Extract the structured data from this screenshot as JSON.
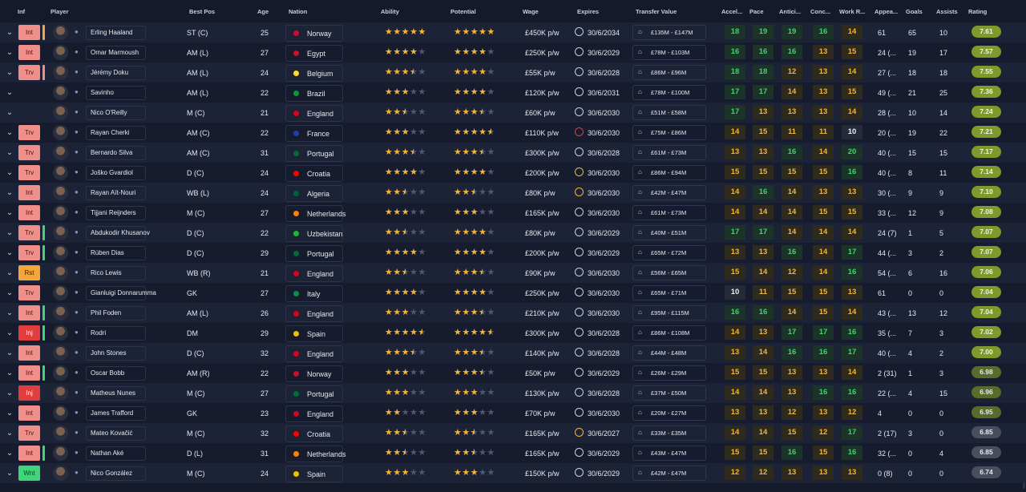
{
  "columns": {
    "inf": "Inf",
    "player": "Player",
    "best_pos": "Best Pos",
    "age": "Age",
    "nation": "Nation",
    "ability": "Ability",
    "potential": "Potential",
    "wage": "Wage",
    "expires": "Expires",
    "transfer_value": "Transfer Value",
    "accel": "Accel...",
    "pace": "Pace",
    "antic": "Antici...",
    "conc": "Conc...",
    "work": "Work R...",
    "appear": "Appea...",
    "goals": "Goals",
    "assists": "Assists",
    "rating": "Rating"
  },
  "colors": {
    "attr_high": "#46d06e",
    "attr_mid": "#f0b63c",
    "attr_low": "#e9eef5",
    "rating_good": "#7f9a2a",
    "rating_mid": "#5a6a2b",
    "rating_low": "#4a4e5c",
    "inf_trv": "#f08f8a",
    "inf_int": "#f08f8a",
    "inf_rst": "#f6a53a",
    "inf_inj": "#e23d3d",
    "inf_wnt": "#3fd67a",
    "star": "#f2b53b"
  },
  "players": [
    {
      "inf": "Int",
      "inf_bar": "#f6a53a",
      "name": "Erling Haaland",
      "best_pos": "ST (C)",
      "age": "25",
      "nation": "Norway",
      "flag": "#c8102e",
      "ability": 5,
      "potential": 5,
      "wage": "£450K p/w",
      "expires": "30/6/2034",
      "clock": "normal",
      "tv": "£135M - £147M",
      "accel": 18,
      "pace": 19,
      "antic": 19,
      "conc": 16,
      "work": 14,
      "appear": "61",
      "goals": "65",
      "assists": "10",
      "rating": "7.61"
    },
    {
      "inf": "Int",
      "inf_bar": "",
      "name": "Omar Marmoush",
      "best_pos": "AM (L)",
      "age": "27",
      "nation": "Egypt",
      "flag": "#ce1126",
      "ability": 4,
      "potential": 4,
      "wage": "£250K p/w",
      "expires": "30/6/2029",
      "clock": "normal",
      "tv": "£78M - £103M",
      "accel": 16,
      "pace": 16,
      "antic": 16,
      "conc": 13,
      "work": 15,
      "appear": "24 (...",
      "goals": "19",
      "assists": "17",
      "rating": "7.57"
    },
    {
      "inf": "Trv",
      "inf_bar": "#f08f8a",
      "name": "Jérémy Doku",
      "best_pos": "AM (L)",
      "age": "24",
      "nation": "Belgium",
      "flag": "#fdda24",
      "ability": 3.5,
      "potential": 4,
      "wage": "£55K p/w",
      "expires": "30/6/2028",
      "clock": "normal",
      "tv": "£86M - £96M",
      "accel": 18,
      "pace": 18,
      "antic": 12,
      "conc": 13,
      "work": 14,
      "appear": "27 (...",
      "goals": "18",
      "assists": "18",
      "rating": "7.55"
    },
    {
      "inf": "",
      "inf_bar": "",
      "name": "Savinho",
      "best_pos": "AM (L)",
      "age": "22",
      "nation": "Brazil",
      "flag": "#009c3b",
      "ability": 3,
      "potential": 4,
      "wage": "£120K p/w",
      "expires": "30/6/2031",
      "clock": "normal",
      "tv": "£78M - £100M",
      "accel": 17,
      "pace": 17,
      "antic": 14,
      "conc": 13,
      "work": 15,
      "appear": "49 (...",
      "goals": "21",
      "assists": "25",
      "rating": "7.36"
    },
    {
      "inf": "",
      "inf_bar": "",
      "name": "Nico O'Reilly",
      "best_pos": "M (C)",
      "age": "21",
      "nation": "England",
      "flag": "#cf081f",
      "ability": 2.5,
      "potential": 3.5,
      "wage": "£60K p/w",
      "expires": "30/6/2030",
      "clock": "normal",
      "tv": "£51M - £58M",
      "accel": 17,
      "pace": 13,
      "antic": 13,
      "conc": 13,
      "work": 14,
      "appear": "28 (...",
      "goals": "10",
      "assists": "14",
      "rating": "7.24"
    },
    {
      "inf": "Trv",
      "inf_bar": "",
      "name": "Rayan Cherki",
      "best_pos": "AM (C)",
      "age": "22",
      "nation": "France",
      "flag": "#1f3fa7",
      "ability": 3,
      "potential": 4.5,
      "wage": "£110K p/w",
      "expires": "30/6/2030",
      "clock": "danger",
      "tv": "£75M - £86M",
      "accel": 14,
      "pace": 15,
      "antic": 11,
      "conc": 11,
      "work": 10,
      "appear": "20 (...",
      "goals": "19",
      "assists": "22",
      "rating": "7.21"
    },
    {
      "inf": "Trv",
      "inf_bar": "",
      "name": "Bernardo Silva",
      "best_pos": "AM (C)",
      "age": "31",
      "nation": "Portugal",
      "flag": "#046a38",
      "ability": 3.5,
      "potential": 3.5,
      "wage": "£300K p/w",
      "expires": "30/6/2028",
      "clock": "normal",
      "tv": "£61M - £73M",
      "accel": 13,
      "pace": 13,
      "antic": 16,
      "conc": 14,
      "work": 20,
      "appear": "40 (...",
      "goals": "15",
      "assists": "15",
      "rating": "7.17"
    },
    {
      "inf": "Trv",
      "inf_bar": "",
      "name": "Joško Gvardiol",
      "best_pos": "D (C)",
      "age": "24",
      "nation": "Croatia",
      "flag": "#ff0000",
      "ability": 4,
      "potential": 4,
      "wage": "£200K p/w",
      "expires": "30/6/2030",
      "clock": "warn",
      "tv": "£86M - £94M",
      "accel": 15,
      "pace": 15,
      "antic": 15,
      "conc": 15,
      "work": 16,
      "appear": "40 (...",
      "goals": "8",
      "assists": "11",
      "rating": "7.14"
    },
    {
      "inf": "Int",
      "inf_bar": "",
      "name": "Rayan Aït-Nouri",
      "best_pos": "WB (L)",
      "age": "24",
      "nation": "Algeria",
      "flag": "#006233",
      "ability": 2.5,
      "potential": 2.5,
      "wage": "£80K p/w",
      "expires": "30/6/2030",
      "clock": "warn",
      "tv": "£42M - £47M",
      "accel": 14,
      "pace": 16,
      "antic": 14,
      "conc": 13,
      "work": 13,
      "appear": "30 (...",
      "goals": "9",
      "assists": "9",
      "rating": "7.10"
    },
    {
      "inf": "Int",
      "inf_bar": "",
      "name": "Tijjani Reijnders",
      "best_pos": "M (C)",
      "age": "27",
      "nation": "Netherlands",
      "flag": "#ff7f00",
      "ability": 3,
      "potential": 3,
      "wage": "£165K p/w",
      "expires": "30/6/2030",
      "clock": "normal",
      "tv": "£61M - £73M",
      "accel": 14,
      "pace": 14,
      "antic": 14,
      "conc": 15,
      "work": 15,
      "appear": "33 (...",
      "goals": "12",
      "assists": "9",
      "rating": "7.08"
    },
    {
      "inf": "Trv",
      "inf_bar": "#3fd67a",
      "name": "Abdukodir Khusanov",
      "best_pos": "D (C)",
      "age": "22",
      "nation": "Uzbekistan",
      "flag": "#1eb53a",
      "ability": 2.5,
      "potential": 4,
      "wage": "£80K p/w",
      "expires": "30/6/2029",
      "clock": "normal",
      "tv": "£40M - £51M",
      "accel": 17,
      "pace": 17,
      "antic": 14,
      "conc": 14,
      "work": 14,
      "appear": "24 (7)",
      "goals": "1",
      "assists": "5",
      "rating": "7.07"
    },
    {
      "inf": "Trv",
      "inf_bar": "#3fd67a",
      "name": "Rúben Dias",
      "best_pos": "D (C)",
      "age": "29",
      "nation": "Portugal",
      "flag": "#046a38",
      "ability": 4,
      "potential": 4,
      "wage": "£200K p/w",
      "expires": "30/6/2029",
      "clock": "normal",
      "tv": "£65M - £72M",
      "accel": 13,
      "pace": 13,
      "antic": 16,
      "conc": 14,
      "work": 17,
      "appear": "44 (...",
      "goals": "3",
      "assists": "2",
      "rating": "7.07"
    },
    {
      "inf": "Rst",
      "inf_bar": "",
      "name": "Rico Lewis",
      "best_pos": "WB (R)",
      "age": "21",
      "nation": "England",
      "flag": "#cf081f",
      "ability": 2.5,
      "potential": 3.5,
      "wage": "£90K p/w",
      "expires": "30/6/2030",
      "clock": "normal",
      "tv": "£56M - £65M",
      "accel": 15,
      "pace": 14,
      "antic": 12,
      "conc": 14,
      "work": 16,
      "appear": "54 (...",
      "goals": "6",
      "assists": "16",
      "rating": "7.06"
    },
    {
      "inf": "Trv",
      "inf_bar": "",
      "name": "Gianluigi Donnarumma",
      "best_pos": "GK",
      "age": "27",
      "nation": "Italy",
      "flag": "#009246",
      "ability": 4,
      "potential": 4,
      "wage": "£250K p/w",
      "expires": "30/6/2030",
      "clock": "normal",
      "tv": "£65M - £71M",
      "accel": 10,
      "pace": 11,
      "antic": 15,
      "conc": 15,
      "work": 13,
      "appear": "61",
      "goals": "0",
      "assists": "0",
      "rating": "7.04"
    },
    {
      "inf": "Int",
      "inf_bar": "#3fd67a",
      "name": "Phil Foden",
      "best_pos": "AM (L)",
      "age": "26",
      "nation": "England",
      "flag": "#cf081f",
      "ability": 3,
      "potential": 3.5,
      "wage": "£210K p/w",
      "expires": "30/6/2030",
      "clock": "normal",
      "tv": "£95M - £115M",
      "accel": 16,
      "pace": 16,
      "antic": 14,
      "conc": 15,
      "work": 14,
      "appear": "43 (...",
      "goals": "13",
      "assists": "12",
      "rating": "7.04"
    },
    {
      "inf": "Inj",
      "inf_bar": "#3fd67a",
      "name": "Rodri",
      "best_pos": "DM",
      "age": "29",
      "nation": "Spain",
      "flag": "#f1bf00",
      "ability": 4.5,
      "potential": 4.5,
      "wage": "£300K p/w",
      "expires": "30/6/2028",
      "clock": "normal",
      "tv": "£86M - £108M",
      "accel": 14,
      "pace": 13,
      "antic": 17,
      "conc": 17,
      "work": 16,
      "appear": "35 (...",
      "goals": "7",
      "assists": "3",
      "rating": "7.02"
    },
    {
      "inf": "Int",
      "inf_bar": "",
      "name": "John Stones",
      "best_pos": "D (C)",
      "age": "32",
      "nation": "England",
      "flag": "#cf081f",
      "ability": 3.5,
      "potential": 3.5,
      "wage": "£140K p/w",
      "expires": "30/6/2028",
      "clock": "normal",
      "tv": "£44M - £48M",
      "accel": 13,
      "pace": 14,
      "antic": 16,
      "conc": 16,
      "work": 17,
      "appear": "40 (...",
      "goals": "4",
      "assists": "2",
      "rating": "7.00"
    },
    {
      "inf": "Int",
      "inf_bar": "#3fd67a",
      "name": "Oscar Bobb",
      "best_pos": "AM (R)",
      "age": "22",
      "nation": "Norway",
      "flag": "#c8102e",
      "ability": 3,
      "potential": 3.5,
      "wage": "£50K p/w",
      "expires": "30/6/2029",
      "clock": "normal",
      "tv": "£26M - £29M",
      "accel": 15,
      "pace": 15,
      "antic": 13,
      "conc": 13,
      "work": 14,
      "appear": "2 (31)",
      "goals": "1",
      "assists": "3",
      "rating": "6.98"
    },
    {
      "inf": "Inj",
      "inf_bar": "",
      "name": "Matheus Nunes",
      "best_pos": "M (C)",
      "age": "27",
      "nation": "Portugal",
      "flag": "#046a38",
      "ability": 3,
      "potential": 3,
      "wage": "£130K p/w",
      "expires": "30/6/2028",
      "clock": "normal",
      "tv": "£37M - £50M",
      "accel": 14,
      "pace": 14,
      "antic": 13,
      "conc": 16,
      "work": 16,
      "appear": "22 (...",
      "goals": "4",
      "assists": "15",
      "rating": "6.96"
    },
    {
      "inf": "Int",
      "inf_bar": "",
      "name": "James Trafford",
      "best_pos": "GK",
      "age": "23",
      "nation": "England",
      "flag": "#cf081f",
      "ability": 2,
      "potential": 3,
      "wage": "£70K p/w",
      "expires": "30/6/2030",
      "clock": "normal",
      "tv": "£20M - £27M",
      "accel": 13,
      "pace": 13,
      "antic": 12,
      "conc": 13,
      "work": 12,
      "appear": "4",
      "goals": "0",
      "assists": "0",
      "rating": "6.95"
    },
    {
      "inf": "Trv",
      "inf_bar": "",
      "name": "Mateo Kovačić",
      "best_pos": "M (C)",
      "age": "32",
      "nation": "Croatia",
      "flag": "#ff0000",
      "ability": 2.5,
      "potential": 2.5,
      "wage": "£165K p/w",
      "expires": "30/6/2027",
      "clock": "warn",
      "tv": "£33M - £35M",
      "accel": 14,
      "pace": 14,
      "antic": 15,
      "conc": 12,
      "work": 17,
      "appear": "2 (17)",
      "goals": "3",
      "assists": "0",
      "rating": "6.85"
    },
    {
      "inf": "Int",
      "inf_bar": "#3fd67a",
      "name": "Nathan Aké",
      "best_pos": "D (L)",
      "age": "31",
      "nation": "Netherlands",
      "flag": "#ff7f00",
      "ability": 2.5,
      "potential": 2.5,
      "wage": "£165K p/w",
      "expires": "30/6/2029",
      "clock": "normal",
      "tv": "£43M - £47M",
      "accel": 15,
      "pace": 15,
      "antic": 16,
      "conc": 15,
      "work": 16,
      "appear": "32 (...",
      "goals": "0",
      "assists": "4",
      "rating": "6.85"
    },
    {
      "inf": "Wnt",
      "inf_bar": "",
      "name": "Nico González",
      "best_pos": "M (C)",
      "age": "24",
      "nation": "Spain",
      "flag": "#f1bf00",
      "ability": 3,
      "potential": 3,
      "wage": "£150K p/w",
      "expires": "30/6/2029",
      "clock": "normal",
      "tv": "£42M - £47M",
      "accel": 12,
      "pace": 12,
      "antic": 13,
      "conc": 13,
      "work": 13,
      "appear": "0 (8)",
      "goals": "0",
      "assists": "0",
      "rating": "6.74"
    }
  ]
}
